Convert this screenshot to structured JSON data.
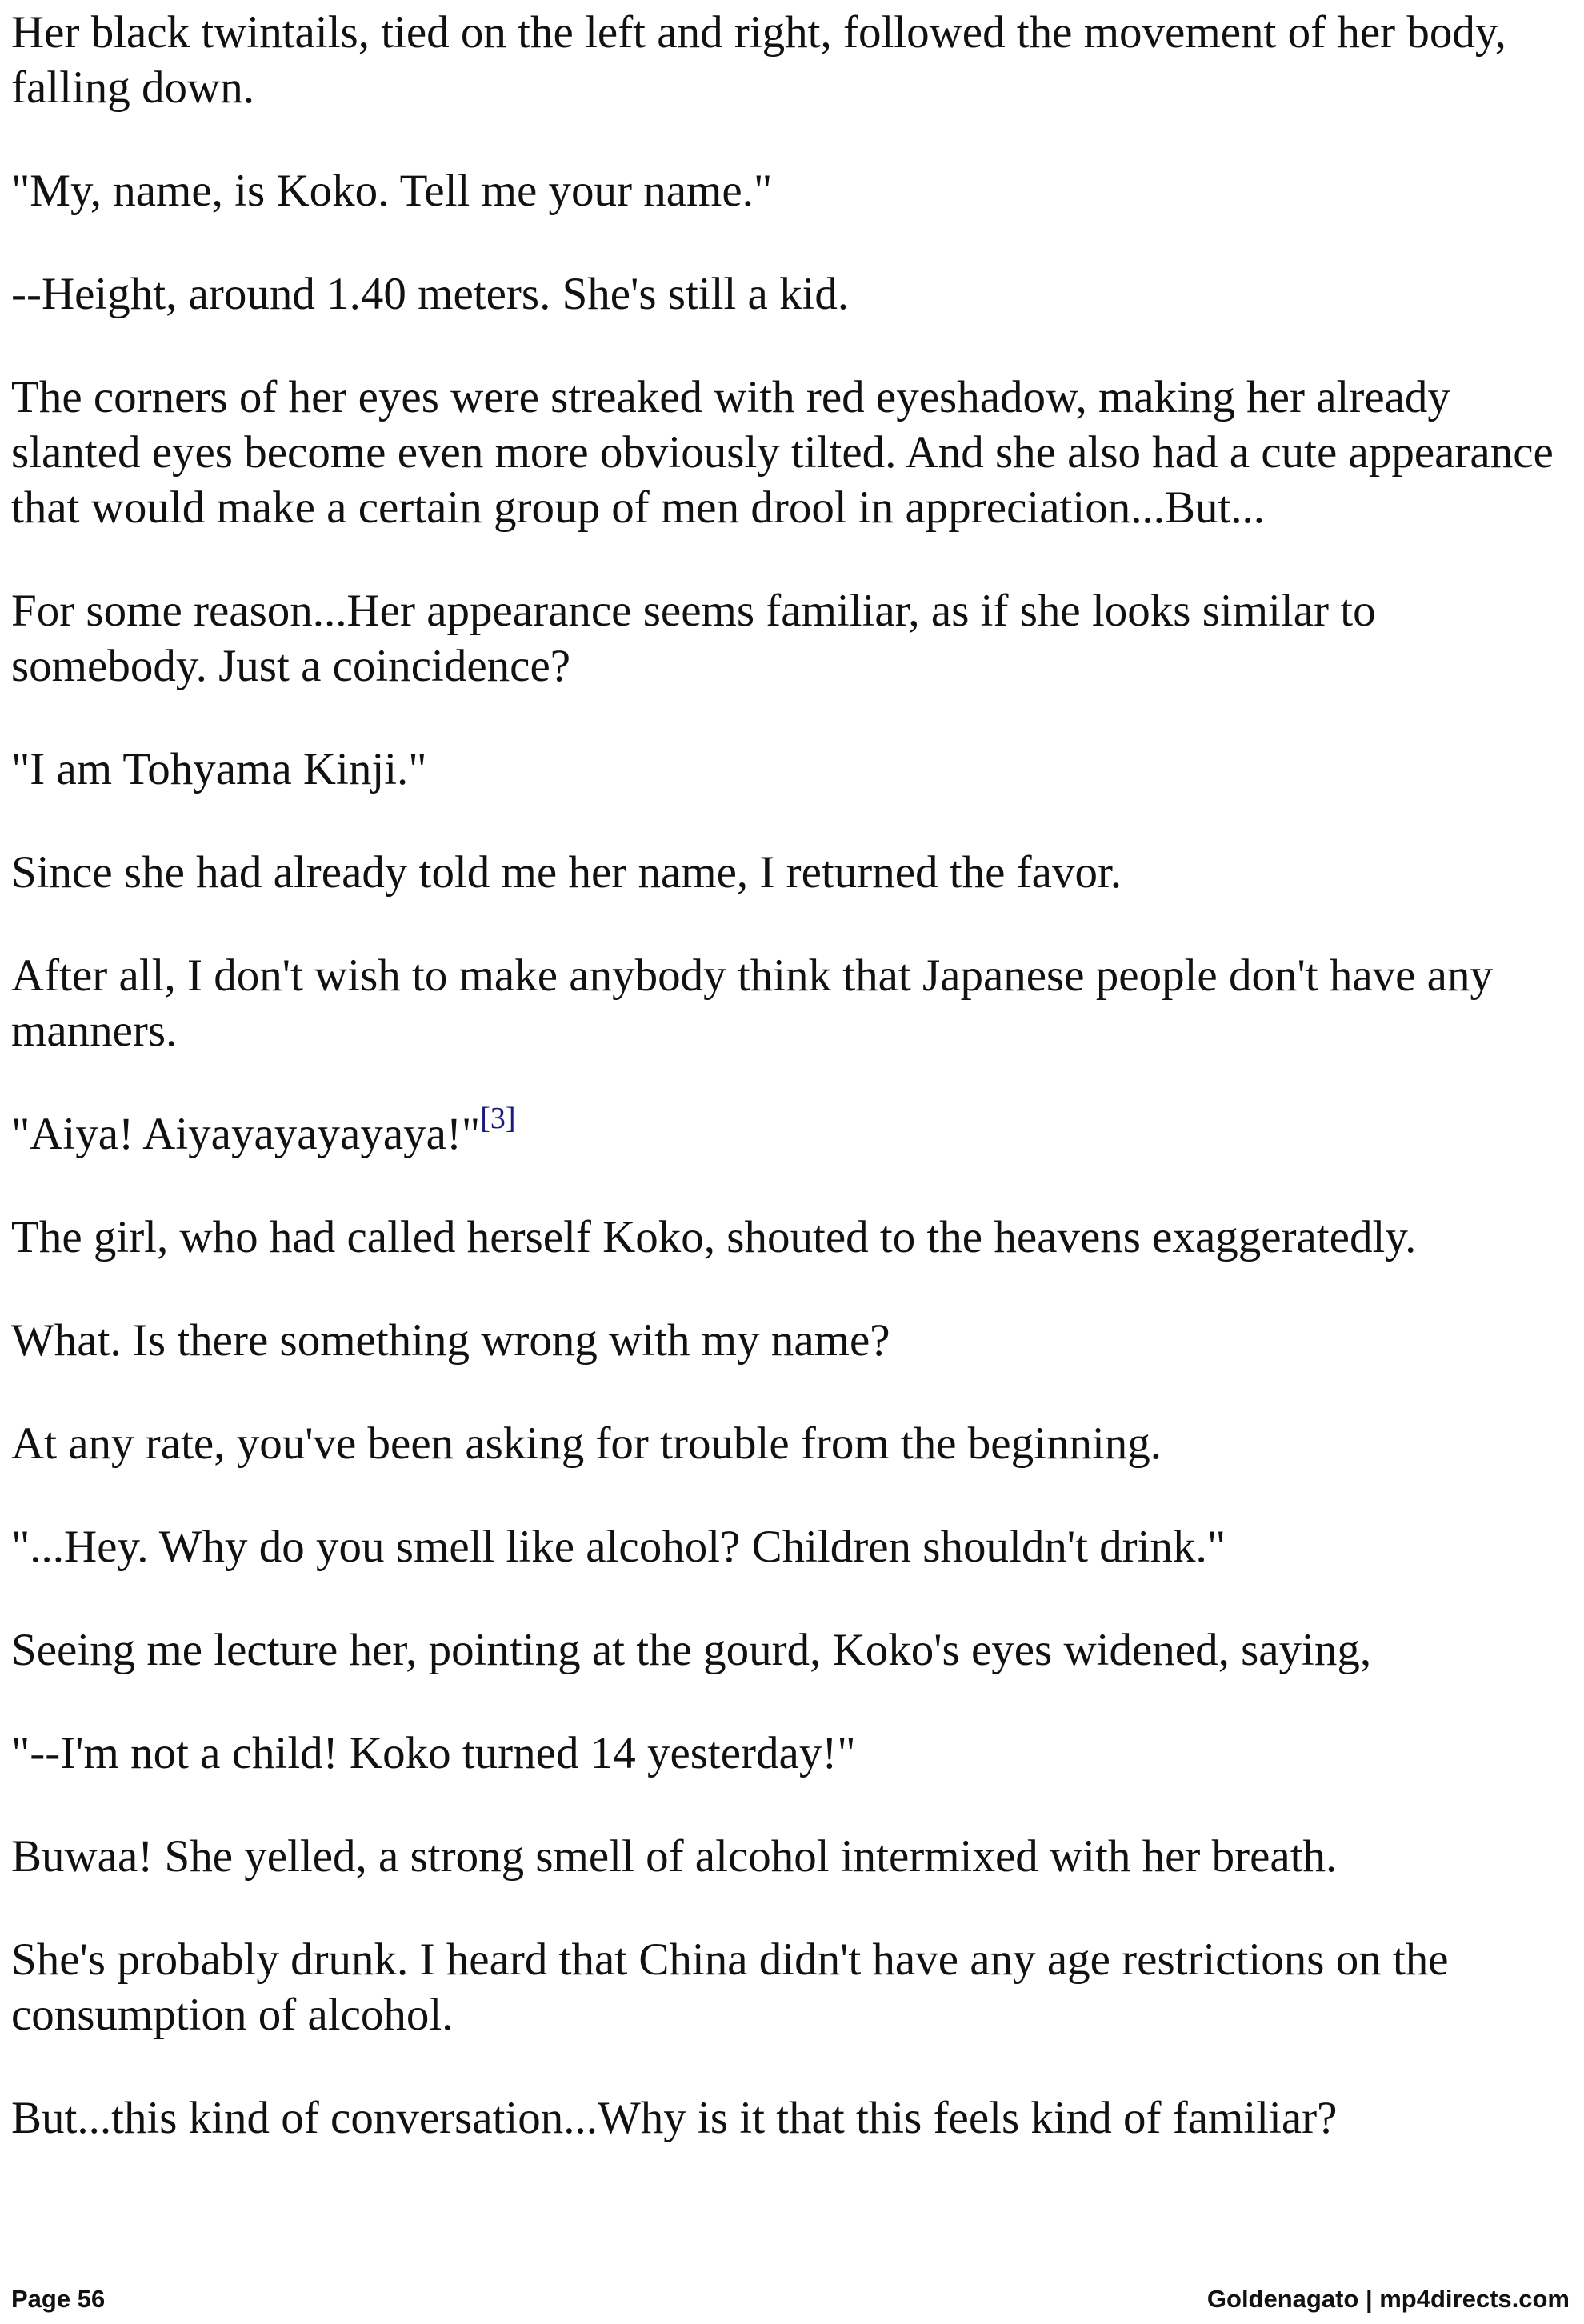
{
  "paragraphs": [
    "Her black twintails, tied on the left and right, followed the movement of her body, falling down.",
    "\"My, name, is Koko. Tell me your name.\"",
    "--Height, around 1.40 meters. She's still a kid.",
    "The corners of her eyes were streaked with red eyeshadow, making her already slanted eyes become even more obviously tilted. And she also had a cute appearance that would make a certain group of men drool in appreciation...But...",
    "For some reason...Her appearance seems familiar, as if she looks similar to somebody. Just a coincidence?",
    "\"I am Tohyama Kinji.\"",
    "Since she had already told me her name, I returned the favor.",
    "After all, I don't wish to make anybody think that Japanese people don't have any manners.",
    "\"Aiya! Aiyayayayayaya!\"",
    "The girl, who had called herself Koko, shouted to the heavens exaggeratedly.",
    "What. Is there something wrong with my name?",
    "At any rate, you've been asking for trouble from the beginning.",
    "\"...Hey. Why do you smell like alcohol? Children shouldn't drink.\"",
    "Seeing me lecture her, pointing at the gourd, Koko's eyes widened, saying,",
    "\"--I'm not a child! Koko turned 14 yesterday!\"",
    "Buwaa! She yelled, a strong smell of alcohol intermixed with her breath.",
    "She's probably drunk. I heard that China didn't have any age restrictions on the consumption of alcohol.",
    "But...this kind of conversation...Why is it that this feels kind of familiar?"
  ],
  "footnote_ref": "[3]",
  "footer": {
    "page_label": "Page 56",
    "credit": "Goldenagato | mp4directs.com"
  },
  "colors": {
    "text": "#111111",
    "footnote_link": "#1a1a80",
    "background": "#ffffff"
  }
}
